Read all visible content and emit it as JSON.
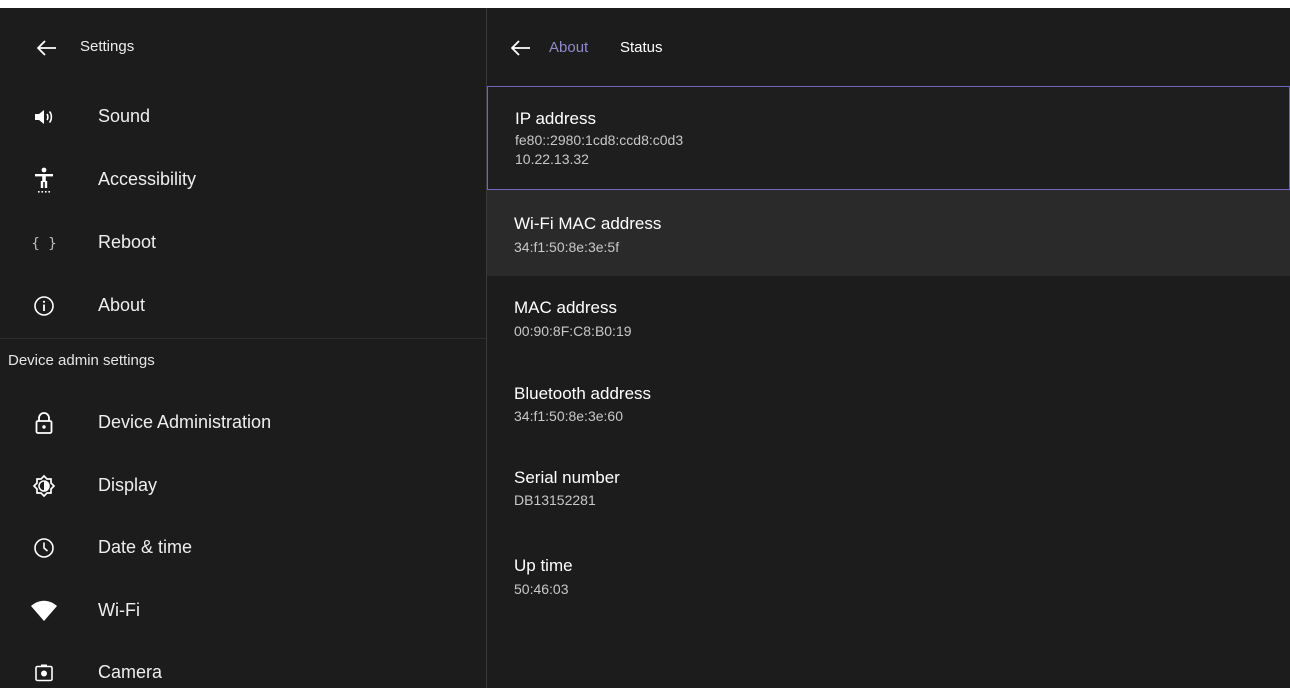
{
  "left": {
    "title": "Settings",
    "back_icon": "arrow-left-icon",
    "items": [
      {
        "label": "Sound",
        "icon": "speaker-icon"
      },
      {
        "label": "Accessibility",
        "icon": "accessibility-icon"
      },
      {
        "label": "Reboot",
        "icon": "braces-icon"
      },
      {
        "label": "About",
        "icon": "info-icon"
      }
    ],
    "section_header": "Device admin settings",
    "admin_items": [
      {
        "label": "Device Administration",
        "icon": "lock-icon"
      },
      {
        "label": "Display",
        "icon": "brightness-icon"
      },
      {
        "label": "Date & time",
        "icon": "clock-icon"
      },
      {
        "label": "Wi-Fi",
        "icon": "wifi-icon"
      },
      {
        "label": "Camera",
        "icon": "camera-icon"
      }
    ]
  },
  "right": {
    "breadcrumb_parent": "About",
    "breadcrumb_current": "Status",
    "items": [
      {
        "label": "IP address",
        "value": "fe80::2980:1cd8:ccd8:c0d3",
        "value2": "10.22.13.32"
      },
      {
        "label": "Wi-Fi MAC address",
        "value": "34:f1:50:8e:3e:5f"
      },
      {
        "label": "MAC address",
        "value": "00:90:8F:C8:B0:19"
      },
      {
        "label": "Bluetooth address",
        "value": "34:f1:50:8e:3e:60"
      },
      {
        "label": "Serial number",
        "value": "DB13152281"
      },
      {
        "label": "Up time",
        "value": "50:46:03"
      }
    ]
  },
  "colors": {
    "background": "#1c1c1c",
    "accent": "#8f8ac8",
    "selected_border": "#6f67b8",
    "hover_bg": "#2a2a2a",
    "text": "#eeeeee"
  }
}
